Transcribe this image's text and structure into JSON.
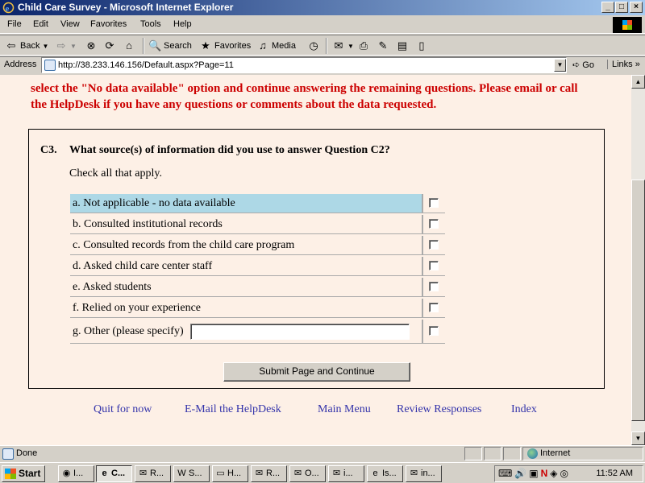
{
  "window": {
    "title": "Child Care Survey - Microsoft Internet Explorer",
    "buttons": {
      "minimize": "_",
      "maximize": "□",
      "close": "×"
    }
  },
  "menu": [
    "File",
    "Edit",
    "View",
    "Favorites",
    "Tools",
    "Help"
  ],
  "toolbar": {
    "back": "Back",
    "search": "Search",
    "favorites": "Favorites",
    "media": "Media"
  },
  "address": {
    "label": "Address",
    "url": "http://38.233.146.156/Default.aspx?Page=11",
    "go": "Go",
    "links": "Links"
  },
  "content": {
    "intro_line1": "select the \"No data available\" option and continue answering the remaining questions. Please email or call",
    "intro_line2": "the HelpDesk if you have any questions or comments about the data requested.",
    "question": {
      "number": "C3.",
      "text": "What source(s) of information did you use to answer Question C2?",
      "instruction": "Check all that apply.",
      "options": [
        {
          "label": "a. Not applicable - no data available",
          "highlighted": true
        },
        {
          "label": "b. Consulted institutional records"
        },
        {
          "label": "c. Consulted records from the child care program"
        },
        {
          "label": "d. Asked child care center staff"
        },
        {
          "label": "e. Asked students"
        },
        {
          "label": "f. Relied on your experience"
        },
        {
          "label": "g. Other (please specify)",
          "other_value": ""
        }
      ],
      "submit": "Submit Page and Continue"
    },
    "footer_links": [
      "Quit for now",
      "E-Mail the HelpDesk",
      "Main Menu",
      "Review Responses",
      "Index"
    ]
  },
  "status": {
    "text": "Done",
    "zone": "Internet"
  },
  "taskbar": {
    "start": "Start",
    "tasks": [
      "I...",
      "C...",
      "R...",
      "S...",
      "H...",
      "R...",
      "O...",
      "i...",
      "Is...",
      "in..."
    ],
    "clock": "11:52 AM"
  },
  "colors": {
    "page_bg": "#fdf0e6",
    "warning_red": "#cc0000",
    "link_blue": "#3333aa",
    "highlight_row": "#add8e6"
  }
}
